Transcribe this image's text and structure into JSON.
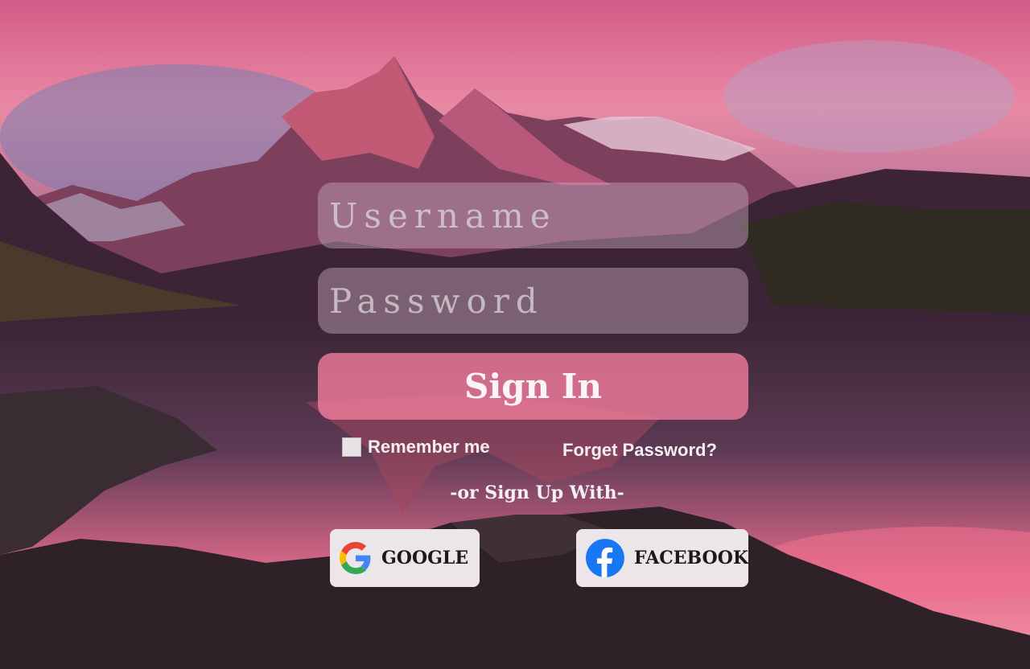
{
  "form": {
    "username_placeholder": "Username",
    "password_placeholder": "Password",
    "signin_label": "Sign In",
    "remember_label": "Remember me",
    "forget_label": "Forget Password?",
    "or_label": "-or Sign Up With-"
  },
  "social": {
    "google_label": "GOOGLE",
    "facebook_label": "FACEBOOK"
  },
  "colors": {
    "signin_button": "#e8788f",
    "facebook_blue": "#1877f2",
    "google_blue": "#4285f4",
    "google_red": "#ea4335",
    "google_yellow": "#fbbc05",
    "google_green": "#34a853"
  },
  "icons": {
    "google": "google-logo-icon",
    "facebook": "facebook-logo-icon",
    "checkbox": "checkbox-icon"
  }
}
